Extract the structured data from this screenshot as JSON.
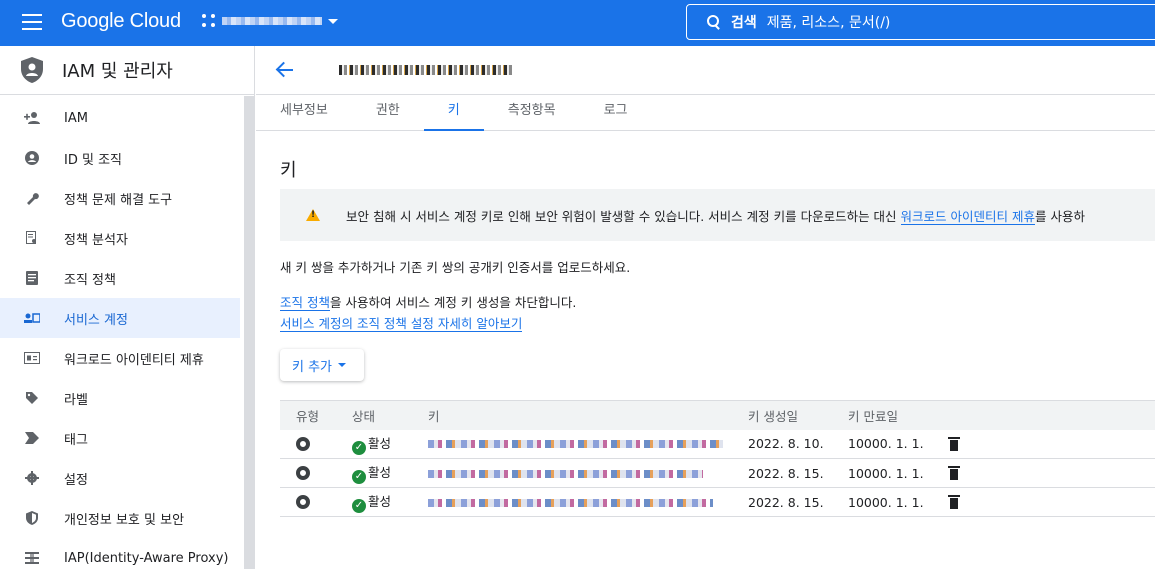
{
  "topbar": {
    "logo": "Google Cloud",
    "search_label": "검색",
    "search_placeholder": "제품, 리소스, 문서(/)"
  },
  "sidebar": {
    "title": "IAM 및 관리자",
    "items": [
      {
        "label": "IAM",
        "icon": "person-add-icon"
      },
      {
        "label": "ID 및 조직",
        "icon": "account-circle-icon"
      },
      {
        "label": "정책 문제 해결 도구",
        "icon": "wrench-icon"
      },
      {
        "label": "정책 분석자",
        "icon": "policy-analyzer-icon"
      },
      {
        "label": "조직 정책",
        "icon": "document-list-icon"
      },
      {
        "label": "서비스 계정",
        "icon": "service-account-icon",
        "active": true
      },
      {
        "label": "워크로드 아이덴티티 제휴",
        "icon": "id-card-icon"
      },
      {
        "label": "라벨",
        "icon": "label-icon"
      },
      {
        "label": "태그",
        "icon": "tag-arrow-icon"
      },
      {
        "label": "설정",
        "icon": "gear-icon"
      },
      {
        "label": "개인정보 보호 및 보안",
        "icon": "shield-icon"
      },
      {
        "label": "IAP(Identity-Aware Proxy)",
        "icon": "iap-icon"
      }
    ]
  },
  "tabs": [
    "세부정보",
    "권한",
    "키",
    "측정항목",
    "로그"
  ],
  "active_tab": "키",
  "content": {
    "heading": "키",
    "banner_text": "보안 침해 시 서비스 계정 키로 인해 보안 위험이 발생할 수 있습니다. 서비스 계정 키를 다운로드하는 대신 ",
    "banner_link": "워크로드 아이덴티티 제휴",
    "banner_tail": "를 사용하",
    "intro": "새 키 쌍을 추가하거나 기존 키 쌍의 공개키 인증서를 업로드하세요.",
    "policy_link": "조직 정책",
    "policy_text": "을 사용하여 서비스 계정 키 생성을 차단합니다.",
    "learn_link": "서비스 계정의 조직 정책 설정 자세히 알아보기",
    "add_key": "키 추가"
  },
  "table": {
    "headers": [
      "유형",
      "상태",
      "키",
      "키 생성일",
      "키 만료일"
    ],
    "rows": [
      {
        "status": "활성",
        "created": "2022. 8. 10.",
        "expires": "10000. 1. 1."
      },
      {
        "status": "활성",
        "created": "2022. 8. 15.",
        "expires": "10000. 1. 1."
      },
      {
        "status": "활성",
        "created": "2022. 8. 15.",
        "expires": "10000. 1. 1."
      }
    ]
  },
  "colors": {
    "accent": "#1a73e8",
    "active_bg": "#e8f0fe",
    "success": "#1e8e3e",
    "warning": "#f9ab00"
  }
}
